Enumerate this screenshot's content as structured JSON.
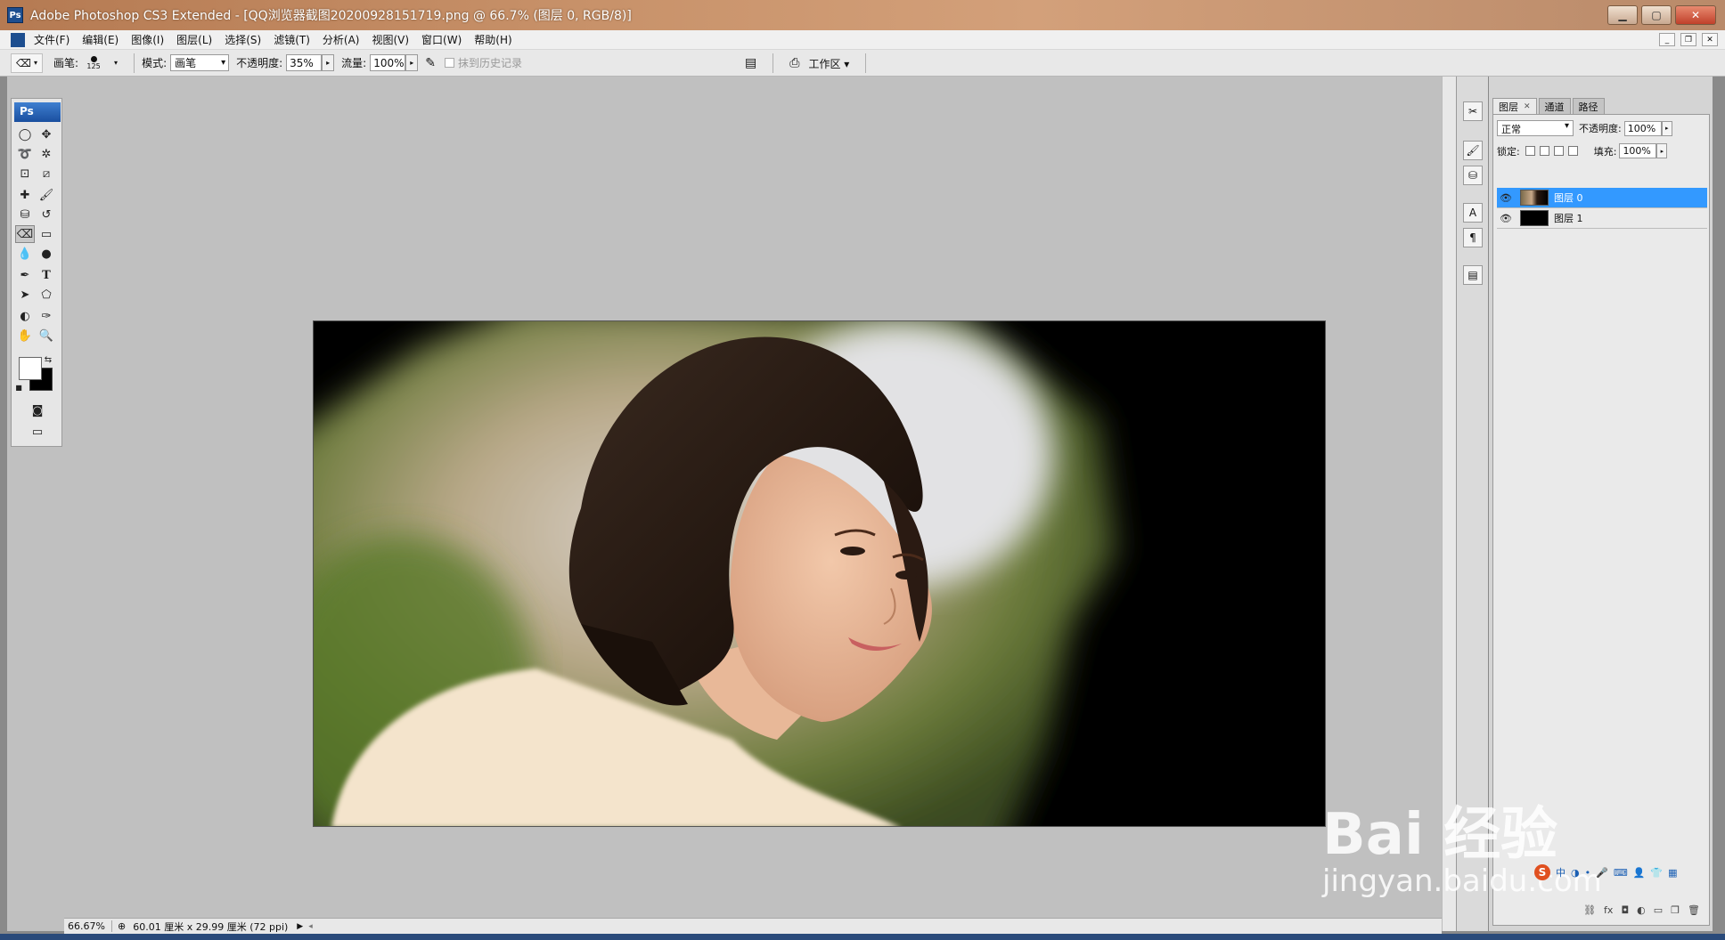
{
  "window": {
    "title": "Adobe Photoshop CS3 Extended - [QQ浏览器截图20200928151719.png @ 66.7% (图层 0, RGB/8)]",
    "app_badge": "Ps"
  },
  "menu": {
    "items": [
      "文件(F)",
      "编辑(E)",
      "图像(I)",
      "图层(L)",
      "选择(S)",
      "滤镜(T)",
      "分析(A)",
      "视图(V)",
      "窗口(W)",
      "帮助(H)"
    ]
  },
  "options": {
    "brush_label": "画笔:",
    "brush_size": "125",
    "mode_label": "模式:",
    "mode_value": "画笔",
    "opacity_label": "不透明度:",
    "opacity_value": "35%",
    "flow_label": "流量:",
    "flow_value": "100%",
    "erase_history_label": "抹到历史记录",
    "workspace_label": "工作区"
  },
  "toolbox": {
    "badge": "Ps",
    "text_tool_glyph": "T"
  },
  "status": {
    "zoom": "66.67%",
    "doc_info": "60.01 厘米 x 29.99 厘米 (72 ppi)"
  },
  "layers": {
    "tabs": [
      "图层",
      "通道",
      "路径"
    ],
    "blend_mode": "正常",
    "opacity_label": "不透明度:",
    "opacity_value": "100%",
    "lock_label": "锁定:",
    "fill_label": "填充:",
    "fill_value": "100%",
    "list": [
      {
        "name": "图层 0",
        "selected": true,
        "thumb": "photo"
      },
      {
        "name": "图层 1",
        "selected": false,
        "thumb": "black"
      }
    ]
  },
  "watermark": {
    "brand": "Bai 经验",
    "url": "jingyan.baidu.com"
  },
  "ime": {
    "badge": "S",
    "mode": "中"
  },
  "colors": {
    "foreground": "#ffffff",
    "background": "#000000",
    "selection": "#3399ff"
  }
}
